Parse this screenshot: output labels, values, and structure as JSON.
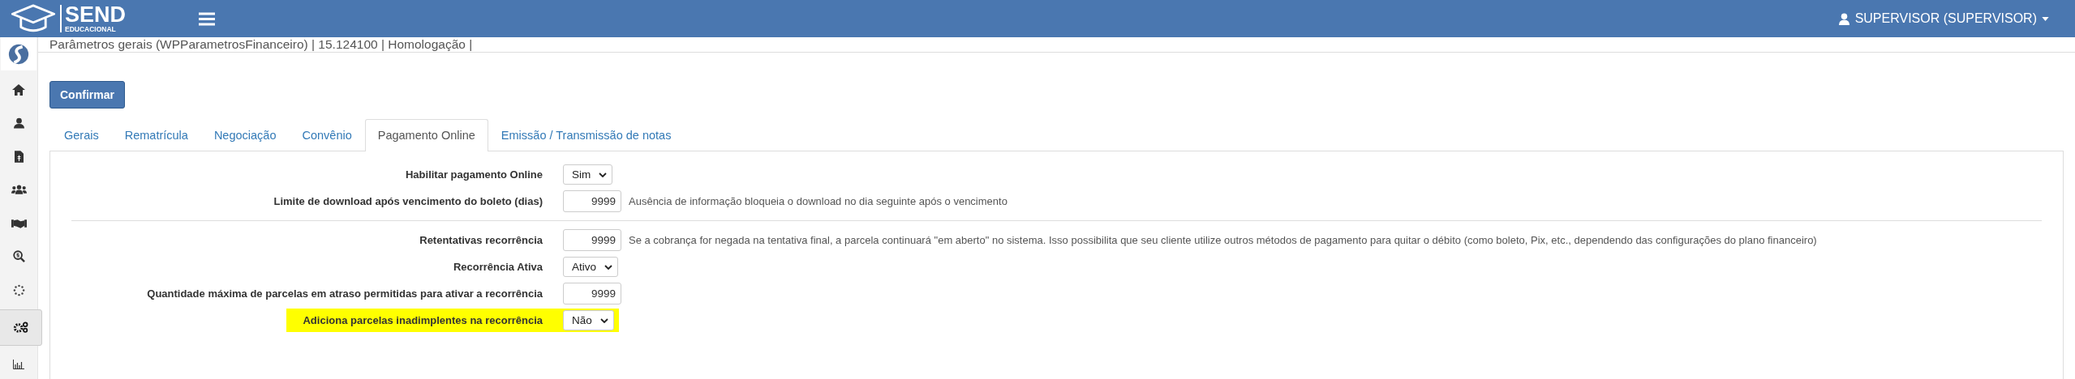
{
  "header": {
    "logo_title": "SEND",
    "logo_subtitle": "EDUCACIONAL",
    "user_menu": "SUPERVISOR (SUPERVISOR)"
  },
  "sidebar": {
    "items": [
      {
        "kind": "home",
        "selected": false
      },
      {
        "kind": "user",
        "selected": false
      },
      {
        "kind": "invoice",
        "selected": false
      },
      {
        "kind": "group",
        "selected": false
      },
      {
        "kind": "handshake",
        "selected": false
      },
      {
        "kind": "search-money",
        "selected": false
      },
      {
        "kind": "spinner",
        "selected": false
      },
      {
        "kind": "gears",
        "selected": true
      },
      {
        "kind": "chart",
        "selected": false
      }
    ]
  },
  "page_title": "Parâmetros gerais (WPParametrosFinanceiro) | 15.124100 | Homologação |",
  "confirm_button": "Confirmar",
  "tabs": [
    {
      "label": "Gerais",
      "selected": false
    },
    {
      "label": "Rematrícula",
      "selected": false
    },
    {
      "label": "Negociação",
      "selected": false
    },
    {
      "label": "Convênio",
      "selected": false
    },
    {
      "label": "Pagamento Online",
      "selected": true
    },
    {
      "label": "Emissão / Transmissão de notas",
      "selected": false
    }
  ],
  "sections": [
    {
      "rows": [
        {
          "label": "Habilitar pagamento Online",
          "kind": "select",
          "value": "Sim",
          "highlighted": false
        },
        {
          "label": "Limite de download após vencimento do boleto (dias)",
          "kind": "number",
          "value": "9999",
          "note": "Ausência de informação bloqueia o download no dia seguinte após o vencimento",
          "highlighted": false
        }
      ]
    },
    {
      "rows": [
        {
          "label": "Retentativas recorrência",
          "kind": "number",
          "value": "9999",
          "note": "Se a cobrança for negada na tentativa final, a parcela continuará \"em aberto\" no sistema. Isso possibilita que seu cliente utilize outros métodos de pagamento para quitar o débito (como boleto, Pix, etc., dependendo das configurações do plano financeiro)",
          "highlighted": false
        },
        {
          "label": "Recorrência Ativa",
          "kind": "select",
          "value": "Ativo",
          "highlighted": false
        },
        {
          "label": "Quantidade máxima de parcelas em atraso permitidas para ativar a recorrência",
          "kind": "number",
          "value": "9999",
          "highlighted": false
        },
        {
          "label": "Adiciona parcelas inadimplentes na recorrência",
          "kind": "select",
          "value": "Não",
          "highlighted": true
        }
      ]
    }
  ]
}
